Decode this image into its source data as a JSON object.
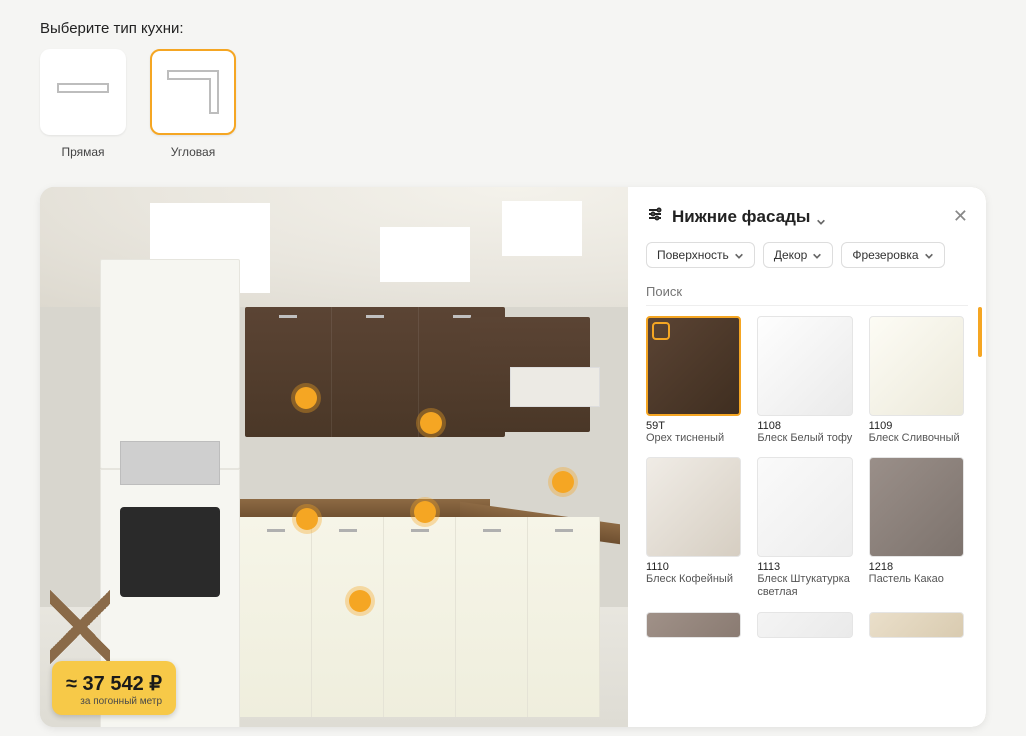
{
  "section_label": "Выберите тип кухни:",
  "types": [
    {
      "label": "Прямая",
      "selected": false
    },
    {
      "label": "Угловая",
      "selected": true
    }
  ],
  "price": {
    "value": "≈ 37 542 ₽",
    "sub": "за погонный метр"
  },
  "panel": {
    "title": "Нижние фасады",
    "filters": [
      {
        "label": "Поверхность"
      },
      {
        "label": "Декор"
      },
      {
        "label": "Фрезеровка"
      }
    ],
    "search_placeholder": "Поиск",
    "swatches": [
      {
        "code": "59T",
        "name": "Орех тисненый",
        "bg": "linear-gradient(135deg,#5b4434,#3f2e20)",
        "selected": true
      },
      {
        "code": "1108",
        "name": "Блеск Белый тофу",
        "bg": "linear-gradient(135deg,#fefefe,#eaeaea)",
        "selected": false
      },
      {
        "code": "1109",
        "name": "Блеск Сливочный",
        "bg": "linear-gradient(135deg,#fdfcf5,#ece9da)",
        "selected": false
      },
      {
        "code": "1110",
        "name": "Блеск Кофейный",
        "bg": "linear-gradient(135deg,#f0ece6,#d6cec2)",
        "selected": false
      },
      {
        "code": "1113",
        "name": "Блеск Штукатурка светлая",
        "bg": "linear-gradient(135deg,#fafafa,#ededed)",
        "selected": false
      },
      {
        "code": "1218",
        "name": "Пастель Какао",
        "bg": "linear-gradient(135deg,#9a8f89,#7d736d)",
        "selected": false
      }
    ],
    "swatches_peek": [
      {
        "bg": "linear-gradient(135deg,#a09188,#8a7b72)"
      },
      {
        "bg": "linear-gradient(135deg,#f4f4f4,#eaeaea)"
      },
      {
        "bg": "linear-gradient(135deg,#eadfca,#d9cbb0)"
      }
    ]
  }
}
